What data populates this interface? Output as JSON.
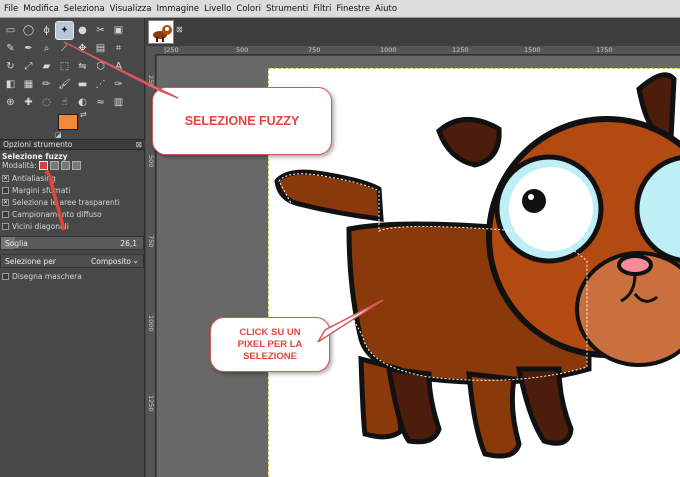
{
  "menu": [
    "File",
    "Modifica",
    "Seleziona",
    "Visualizza",
    "Immagine",
    "Livello",
    "Colori",
    "Strumenti",
    "Filtri",
    "Finestre",
    "Aiuto"
  ],
  "toolbox": {
    "tools": [
      {
        "name": "rect-select-tool-icon",
        "glyph": "▭"
      },
      {
        "name": "ellipse-select-tool-icon",
        "glyph": "◯"
      },
      {
        "name": "free-select-tool-icon",
        "glyph": "ϕ"
      },
      {
        "name": "fuzzy-select-tool-icon",
        "glyph": "✦",
        "active": true
      },
      {
        "name": "select-by-color-tool-icon",
        "glyph": "●"
      },
      {
        "name": "scissors-select-tool-icon",
        "glyph": "✂"
      },
      {
        "name": "foreground-select-tool-icon",
        "glyph": "▣"
      },
      {
        "name": "paths-tool-icon",
        "glyph": "✎"
      },
      {
        "name": "color-picker-tool-icon",
        "glyph": "✒"
      },
      {
        "name": "zoom-tool-icon",
        "glyph": "⌕"
      },
      {
        "name": "measure-tool-icon",
        "glyph": "⟋"
      },
      {
        "name": "move-tool-icon",
        "glyph": "✥"
      },
      {
        "name": "align-tool-icon",
        "glyph": "▤"
      },
      {
        "name": "crop-tool-icon",
        "glyph": "⌗"
      },
      {
        "name": "rotate-tool-icon",
        "glyph": "↻"
      },
      {
        "name": "scale-tool-icon",
        "glyph": "⤢"
      },
      {
        "name": "shear-tool-icon",
        "glyph": "▰"
      },
      {
        "name": "perspective-tool-icon",
        "glyph": "⬚"
      },
      {
        "name": "flip-tool-icon",
        "glyph": "⇋"
      },
      {
        "name": "cage-tool-icon",
        "glyph": "⬡"
      },
      {
        "name": "text-tool-icon",
        "glyph": "A"
      },
      {
        "name": "bucket-fill-tool-icon",
        "glyph": "◧"
      },
      {
        "name": "blend-tool-icon",
        "glyph": "▦"
      },
      {
        "name": "pencil-tool-icon",
        "glyph": "✏"
      },
      {
        "name": "paintbrush-tool-icon",
        "glyph": "🖌"
      },
      {
        "name": "eraser-tool-icon",
        "glyph": "▬"
      },
      {
        "name": "airbrush-tool-icon",
        "glyph": "⋰"
      },
      {
        "name": "ink-tool-icon",
        "glyph": "✑"
      },
      {
        "name": "clone-tool-icon",
        "glyph": "⊕"
      },
      {
        "name": "heal-tool-icon",
        "glyph": "✚"
      },
      {
        "name": "blur-tool-icon",
        "glyph": "◌"
      },
      {
        "name": "smudge-tool-icon",
        "glyph": "☝"
      },
      {
        "name": "dodge-burn-tool-icon",
        "glyph": "◐"
      },
      {
        "name": "warp-tool-icon",
        "glyph": "≈"
      },
      {
        "name": "mypaint-tool-icon",
        "glyph": "▥"
      }
    ]
  },
  "colors": {
    "foreground": "#f0893b",
    "background": "#ffffff"
  },
  "options": {
    "tab_label": "Opzioni strumento",
    "title": "Selezione fuzzy",
    "mode_label": "Modalità:",
    "antialiasing": "Antialiasing",
    "feather": "Margini sfumati",
    "select_transparent": "Seleziona le aree trasparenti",
    "sample_merged": "Campionamento diffuso",
    "diagonal": "Vicini diagonali",
    "threshold_label": "Soglia",
    "threshold_value": "26,1",
    "threshold_fraction": 0.1,
    "select_by_label": "Selezione per",
    "select_by_value": "Composito",
    "draw_mask": "Disegna maschera"
  },
  "rulers": {
    "top": [
      "|250",
      "500",
      "750",
      "1000",
      "1250",
      "1500",
      "1750"
    ],
    "left": [
      "250",
      "500",
      "750",
      "1000",
      "1250"
    ]
  },
  "callouts": {
    "fuzzy": "SELEZIONE FUZZY",
    "click_line1": "CLICK SU UN",
    "click_line2": "PIXEL PER LA",
    "click_line3": "SELEZIONE"
  },
  "accent": "#e0463b"
}
